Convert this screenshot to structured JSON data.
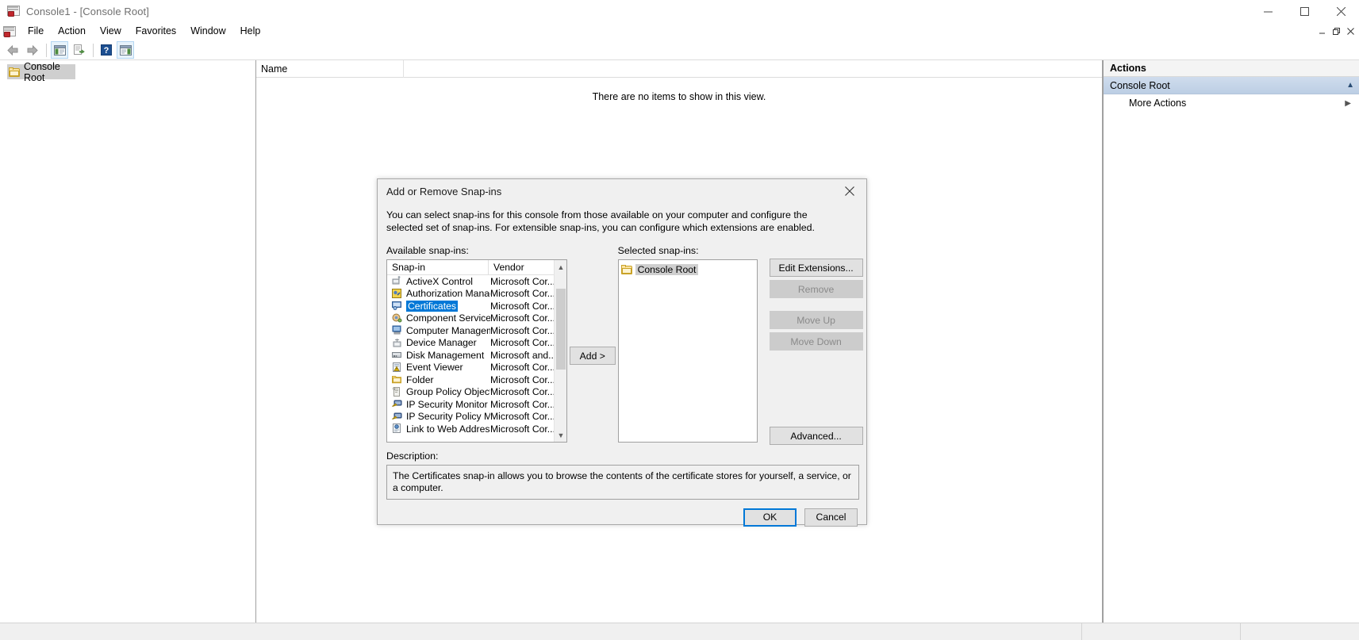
{
  "window": {
    "title": "Console1 - [Console Root]",
    "app_icon": "mmc-console-icon",
    "minimize_label": "Minimize",
    "maximize_label": "Maximize",
    "close_label": "Close"
  },
  "menubar": {
    "items": [
      {
        "label": "File"
      },
      {
        "label": "Action"
      },
      {
        "label": "View"
      },
      {
        "label": "Favorites"
      },
      {
        "label": "Window"
      },
      {
        "label": "Help"
      }
    ],
    "mdi": {
      "minimize": "–",
      "restore": "❐",
      "close": "✕"
    }
  },
  "toolbar": {
    "buttons": [
      {
        "name": "back-icon",
        "glyph": "←"
      },
      {
        "name": "forward-icon",
        "glyph": "→"
      },
      {
        "name": "show-hide-console-tree-icon",
        "glyph": ""
      },
      {
        "name": "export-list-icon",
        "glyph": ""
      },
      {
        "name": "help-icon",
        "glyph": "?"
      },
      {
        "name": "show-hide-action-pane-icon",
        "glyph": ""
      }
    ]
  },
  "tree": {
    "root_label": "Console Root",
    "root_icon": "folder-icon"
  },
  "list_pane": {
    "columns": [
      "Name"
    ],
    "empty_message": "There are no items to show in this view."
  },
  "actions_pane": {
    "header": "Actions",
    "group": "Console Root",
    "items": [
      {
        "label": "More Actions",
        "has_submenu": true
      }
    ]
  },
  "dialog": {
    "title": "Add or Remove Snap-ins",
    "close_glyph": "✕",
    "intro": "You can select snap-ins for this console from those available on your computer and configure the selected set of snap-ins. For extensible snap-ins, you can configure which extensions are enabled.",
    "available_label": "Available snap-ins:",
    "selected_label": "Selected snap-ins:",
    "columns": {
      "name": "Snap-in",
      "vendor": "Vendor"
    },
    "available": [
      {
        "name": "ActiveX Control",
        "vendor": "Microsoft Cor...",
        "icon": "activex-control-icon",
        "selected": false
      },
      {
        "name": "Authorization Manager",
        "vendor": "Microsoft Cor...",
        "icon": "authorization-manager-icon",
        "selected": false
      },
      {
        "name": "Certificates",
        "vendor": "Microsoft Cor...",
        "icon": "certificates-icon",
        "selected": true
      },
      {
        "name": "Component Services",
        "vendor": "Microsoft Cor...",
        "icon": "component-services-icon",
        "selected": false
      },
      {
        "name": "Computer Managem...",
        "vendor": "Microsoft Cor...",
        "icon": "computer-management-icon",
        "selected": false
      },
      {
        "name": "Device Manager",
        "vendor": "Microsoft Cor...",
        "icon": "device-manager-icon",
        "selected": false
      },
      {
        "name": "Disk Management",
        "vendor": "Microsoft and...",
        "icon": "disk-management-icon",
        "selected": false
      },
      {
        "name": "Event Viewer",
        "vendor": "Microsoft Cor...",
        "icon": "event-viewer-icon",
        "selected": false
      },
      {
        "name": "Folder",
        "vendor": "Microsoft Cor...",
        "icon": "folder-icon",
        "selected": false
      },
      {
        "name": "Group Policy Object ...",
        "vendor": "Microsoft Cor...",
        "icon": "group-policy-object-icon",
        "selected": false
      },
      {
        "name": "IP Security Monitor",
        "vendor": "Microsoft Cor...",
        "icon": "ip-security-monitor-icon",
        "selected": false
      },
      {
        "name": "IP Security Policy M...",
        "vendor": "Microsoft Cor...",
        "icon": "ip-security-policy-icon",
        "selected": false
      },
      {
        "name": "Link to Web Address",
        "vendor": "Microsoft Cor...",
        "icon": "link-to-web-address-icon",
        "selected": false
      }
    ],
    "add_button": "Add >",
    "selected": [
      {
        "name": "Console Root",
        "icon": "folder-icon"
      }
    ],
    "side_buttons": [
      {
        "label": "Edit Extensions...",
        "enabled": true
      },
      {
        "label": "Remove",
        "enabled": false
      },
      {
        "label": "Move Up",
        "enabled": false
      },
      {
        "label": "Move Down",
        "enabled": false
      }
    ],
    "advanced_button": "Advanced...",
    "description_label": "Description:",
    "description_text": "The Certificates snap-in allows you to browse the contents of the certificate stores for yourself, a service, or a computer.",
    "ok_button": "OK",
    "cancel_button": "Cancel"
  },
  "colors": {
    "selection_blue": "#0078d7",
    "dialog_bg": "#f0f0f0",
    "actions_group": "#bccee4"
  }
}
